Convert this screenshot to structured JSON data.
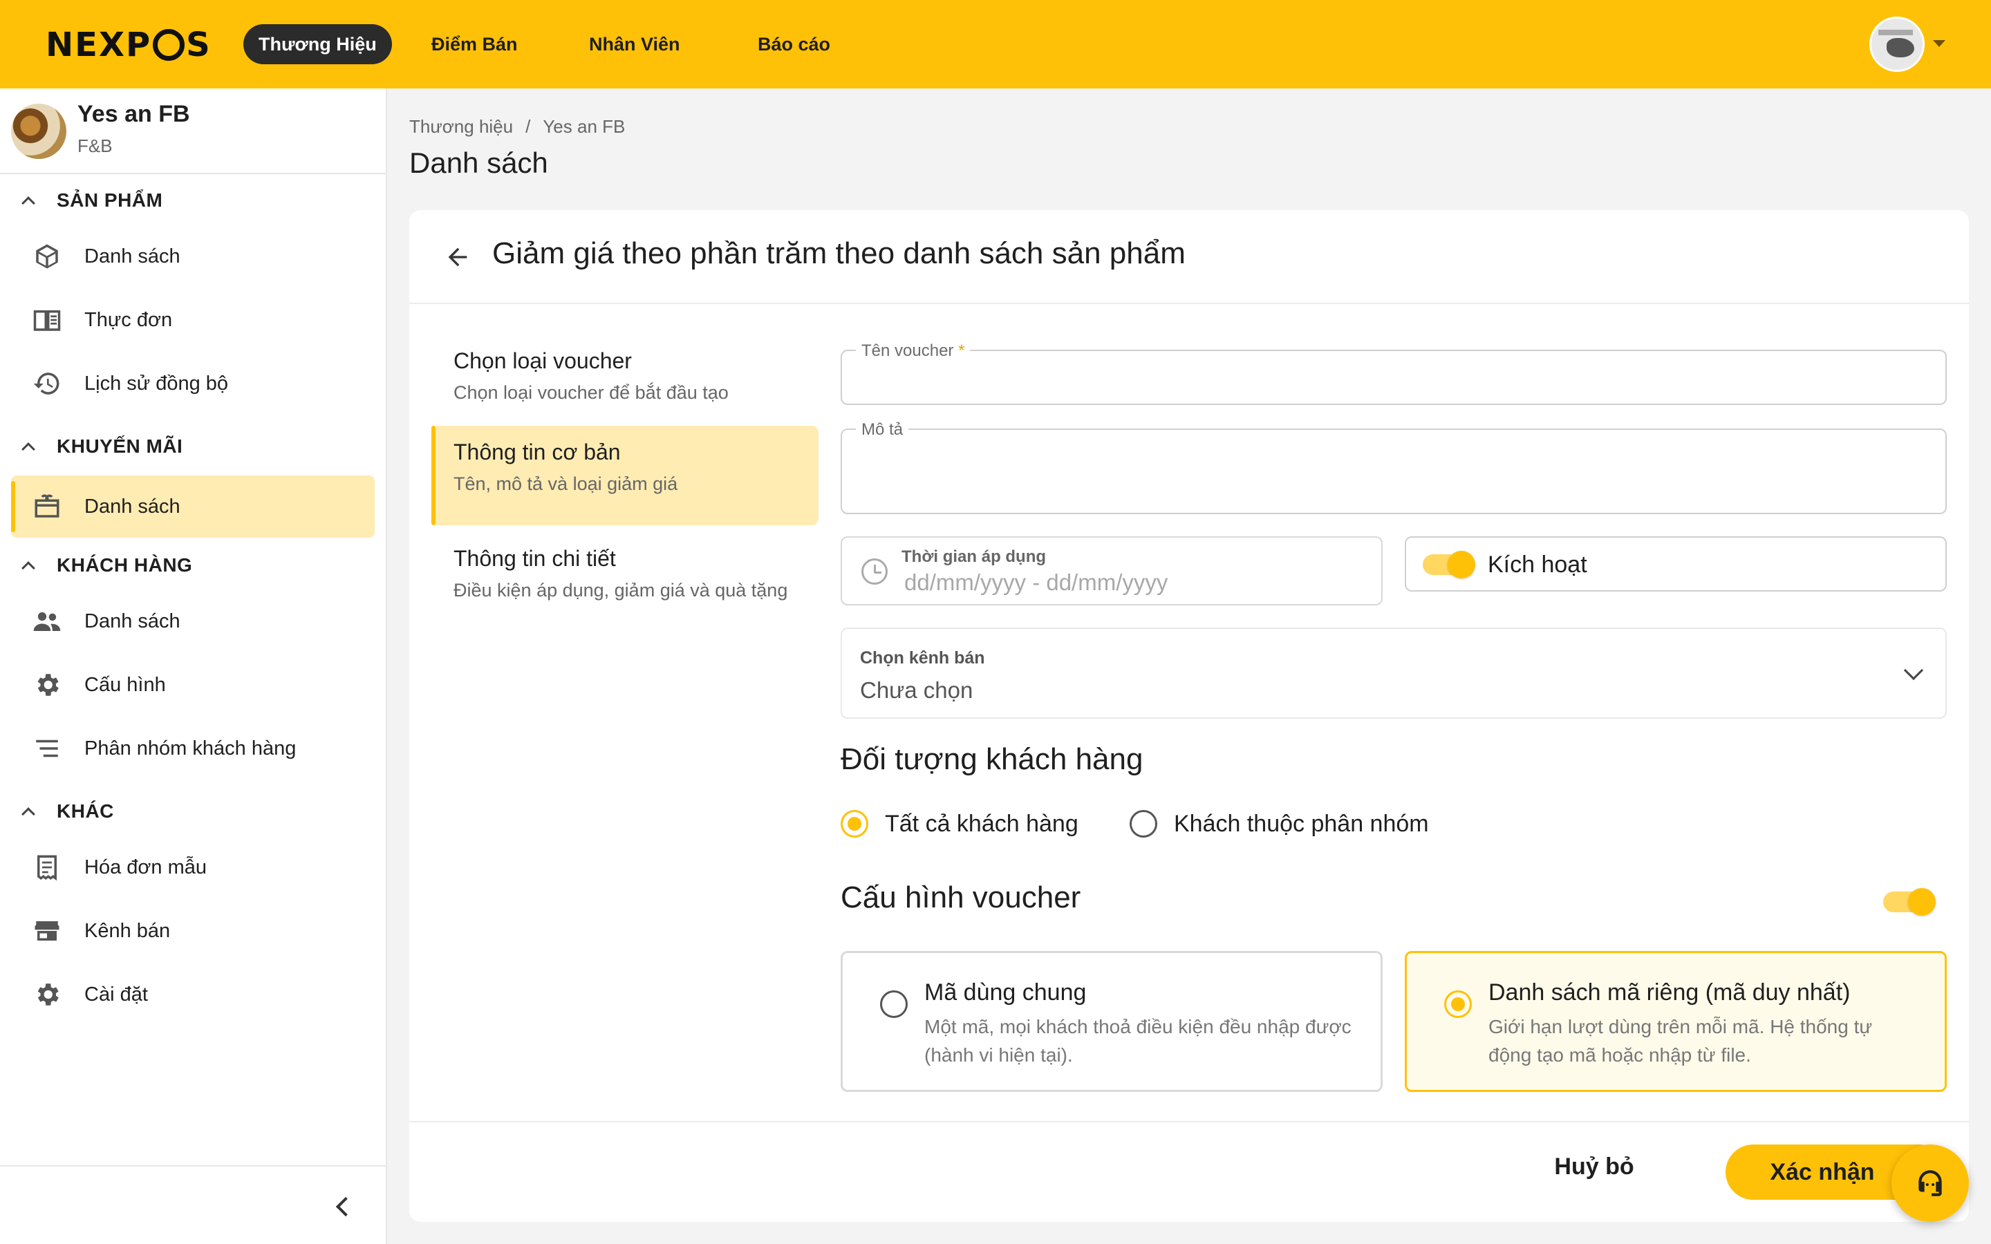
{
  "brand_logo": "NEXPOS",
  "nav": {
    "items": [
      "Thương Hiệu",
      "Điểm Bán",
      "Nhân Viên",
      "Báo cáo"
    ],
    "active": 0
  },
  "sidebar": {
    "store_name": "Yes an FB",
    "store_type": "F&B",
    "sections": [
      {
        "title": "SẢN PHẨM",
        "items": [
          {
            "label": "Danh sách",
            "icon": "box-icon"
          },
          {
            "label": "Thực đơn",
            "icon": "menu-book-icon"
          },
          {
            "label": "Lịch sử đồng bộ",
            "icon": "history-icon"
          }
        ]
      },
      {
        "title": "KHUYẾN MÃI",
        "items": [
          {
            "label": "Danh sách",
            "icon": "gift-card-icon",
            "active": true
          }
        ]
      },
      {
        "title": "KHÁCH HÀNG",
        "items": [
          {
            "label": "Danh sách",
            "icon": "people-icon"
          },
          {
            "label": "Cấu hình",
            "icon": "gear-icon"
          },
          {
            "label": "Phân nhóm khách hàng",
            "icon": "list-icon"
          }
        ]
      },
      {
        "title": "KHÁC",
        "items": [
          {
            "label": "Hóa đơn mẫu",
            "icon": "receipt-icon"
          },
          {
            "label": "Kênh bán",
            "icon": "store-icon"
          },
          {
            "label": "Cài đặt",
            "icon": "gear-icon"
          }
        ]
      }
    ]
  },
  "breadcrumb": {
    "items": [
      "Thương hiệu",
      "Yes an FB"
    ],
    "separator": "/"
  },
  "page_title": "Danh sách",
  "form": {
    "title": "Giảm giá theo phần trăm theo danh sách sản phẩm",
    "steps": [
      {
        "title": "Chọn loại voucher",
        "desc": "Chọn loại voucher để bắt đầu tạo"
      },
      {
        "title": "Thông tin cơ bản",
        "desc": "Tên, mô tả và loại giảm giá",
        "active": true
      },
      {
        "title": "Thông tin chi tiết",
        "desc": "Điều kiện áp dụng, giảm giá và quà tặng"
      }
    ],
    "name_label": "Tên voucher",
    "name_required": "*",
    "name_value": "",
    "desc_label": "Mô tả",
    "desc_value": "",
    "date_label": "Thời gian áp dụng",
    "date_placeholder": "dd/mm/yyyy - dd/mm/yyyy",
    "active_label": "Kích hoạt",
    "active_on": true,
    "channel_label": "Chọn kênh bán",
    "channel_value": "Chưa chọn",
    "audience_title": "Đối tượng khách hàng",
    "audience_options": [
      "Tất cả khách hàng",
      "Khách thuộc phân nhóm"
    ],
    "audience_selected": 0,
    "config_title": "Cấu hình voucher",
    "config_enabled": true,
    "code_options": [
      {
        "title": "Mã dùng chung",
        "desc": "Một mã, mọi khách thoả điều kiện đều nhập được (hành vi hiện tại)."
      },
      {
        "title": "Danh sách mã riêng (mã duy nhất)",
        "desc": "Giới hạn lượt dùng trên mỗi mã. Hệ thống tự động tạo mã hoặc nhập từ file.",
        "selected": true
      }
    ],
    "cancel_label": "Huỷ bỏ",
    "confirm_label": "Xác nhận"
  },
  "colors": {
    "accent": "#ffc107",
    "accent_light": "#ffecb3",
    "dark": "#2b2b2b"
  }
}
